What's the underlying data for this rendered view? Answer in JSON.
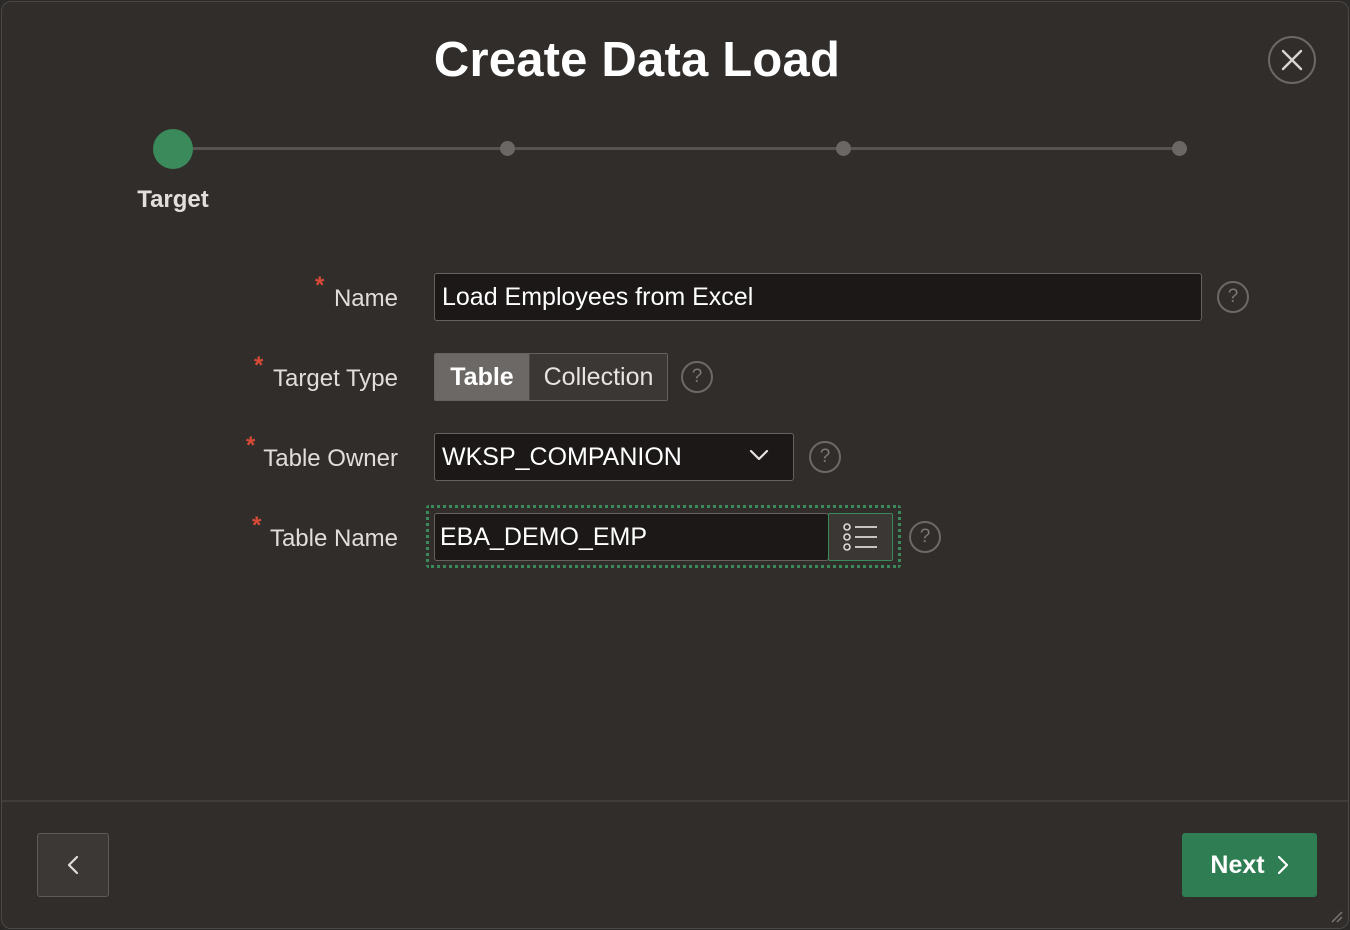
{
  "dialog": {
    "title": "Create Data Load",
    "close_icon": "close-icon"
  },
  "wizard": {
    "current_step_label": "Target",
    "total_steps": 4,
    "current_step": 1
  },
  "form": {
    "name": {
      "label": "Name",
      "value": "Load Employees from Excel",
      "required": "*"
    },
    "target_type": {
      "label": "Target Type",
      "options": [
        "Table",
        "Collection"
      ],
      "selected": "Table",
      "required": "*"
    },
    "table_owner": {
      "label": "Table Owner",
      "value": "WKSP_COMPANION",
      "required": "*"
    },
    "table_name": {
      "label": "Table Name",
      "value": "EBA_DEMO_EMP",
      "required": "*"
    },
    "help_glyph": "?"
  },
  "footer": {
    "next_label": "Next"
  },
  "colors": {
    "accent": "#3a8a5b",
    "required": "#d94b37",
    "background": "#302d2a"
  }
}
